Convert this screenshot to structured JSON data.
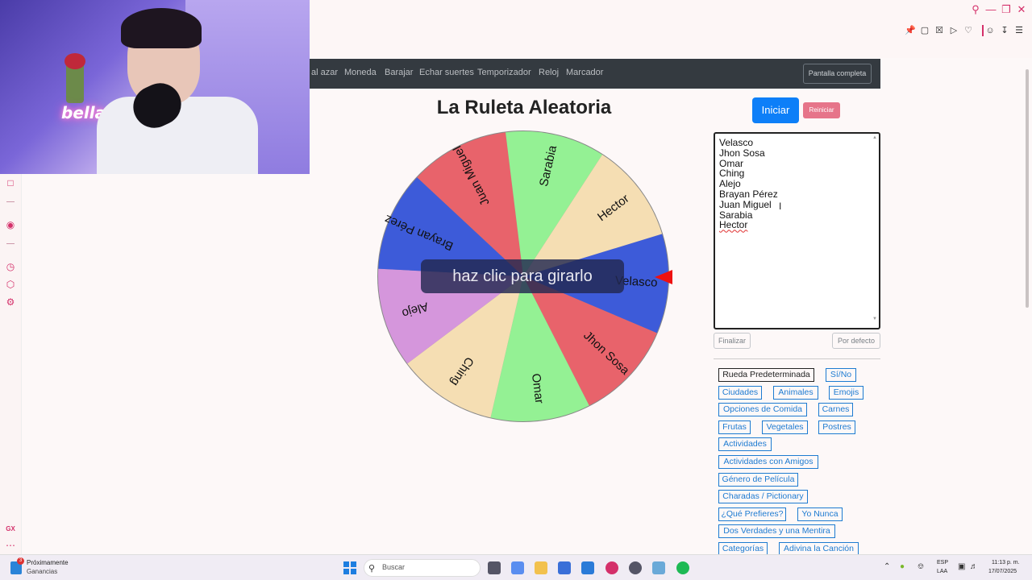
{
  "nav": {
    "links": [
      "al azar",
      "Moneda",
      "Barajar",
      "Echar suertes",
      "Temporizador",
      "Reloj",
      "Marcador"
    ],
    "fullscreen": "Pantalla completa"
  },
  "title": "La Ruleta Aleatoria",
  "buttons": {
    "start": "Iniciar",
    "reset": "Reiniciar",
    "finish": "Finalizar",
    "default": "Por defecto"
  },
  "wheel": {
    "overlay": "haz clic para girarlo",
    "segments": [
      {
        "label": "Velasco",
        "color": "#3d5bd9"
      },
      {
        "label": "Jhon Sosa",
        "color": "#e8636b"
      },
      {
        "label": "Omar",
        "color": "#94f194"
      },
      {
        "label": "Ching",
        "color": "#f5deb3"
      },
      {
        "label": "Alejo",
        "color": "#d596dc"
      },
      {
        "label": "Brayan Pérez",
        "color": "#3d5bd9"
      },
      {
        "label": "Juan Miguel",
        "color": "#e8636b"
      },
      {
        "label": "Sarabia",
        "color": "#94f194"
      },
      {
        "label": "Hector",
        "color": "#f5deb3"
      }
    ]
  },
  "names": [
    "Velasco",
    "Jhon Sosa",
    "Omar",
    "Ching",
    "Alejo",
    "Brayan Pérez",
    "Juan Miguel",
    "Sarabia",
    "Hector"
  ],
  "categories": [
    "Rueda Predeterminada",
    "Sí/No",
    "Ciudades",
    "Animales",
    "Emojis",
    "Opciones de Comida",
    "Carnes",
    "Frutas",
    "Vegetales",
    "Postres",
    "Actividades",
    "Actividades con Amigos",
    "Género de Película",
    "Charadas / Pictionary",
    "¿Qué Prefieres?",
    "Yo Nunca",
    "Dos Verdades y una Mentira",
    "Categorías",
    "Adivina la Canción"
  ],
  "webcam": {
    "sign_text": "bella"
  },
  "taskbar": {
    "news_title": "Próximamente",
    "news_sub": "Ganancias",
    "news_badge": "3",
    "search": "Buscar",
    "lang_a": "ESP",
    "lang_b": "LAA",
    "time": "11:13 p. m.",
    "date": "17/07/2025"
  },
  "sidebar": {
    "label": "GX"
  },
  "colors": {
    "accent": "#d4306a",
    "primary": "#0d7ff8",
    "danger": "#e6758a",
    "category": "#1d7bd1"
  }
}
